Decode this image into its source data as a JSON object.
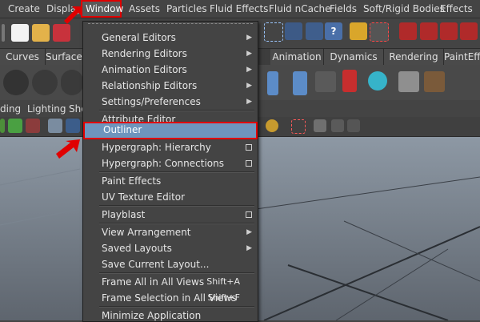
{
  "menubar": {
    "items": [
      "Create",
      "Display",
      "Window",
      "Assets",
      "Particles",
      "Fluid Effects",
      "Fluid nCache",
      "Fields",
      "Soft/Rigid Bodies",
      "Effects"
    ]
  },
  "shelf_tabs": [
    "Curves",
    "Surfaces",
    "Animation",
    "Dynamics",
    "Rendering",
    "PaintEff"
  ],
  "panel_menu": [
    "ding",
    "Lighting",
    "Sho"
  ],
  "window_menu": {
    "items": [
      {
        "label": "General Editors",
        "submenu": true
      },
      {
        "label": "Rendering Editors",
        "submenu": true
      },
      {
        "label": "Animation Editors",
        "submenu": true
      },
      {
        "label": "Relationship Editors",
        "submenu": true
      },
      {
        "label": "Settings/Preferences",
        "submenu": true
      },
      {
        "label": "Attribute Editor"
      },
      {
        "label": "Outliner",
        "highlighted": true
      },
      {
        "label": "Hypergraph: Hierarchy",
        "option_box": true
      },
      {
        "label": "Hypergraph: Connections",
        "option_box": true
      },
      {
        "label": "Paint Effects"
      },
      {
        "label": "UV Texture Editor"
      },
      {
        "label": "Playblast",
        "option_box": true
      },
      {
        "label": "View Arrangement",
        "submenu": true
      },
      {
        "label": "Saved Layouts",
        "submenu": true
      },
      {
        "label": "Save Current Layout..."
      },
      {
        "label": "Frame All in All Views",
        "shortcut": "Shift+A"
      },
      {
        "label": "Frame Selection in All Views",
        "shortcut": "Shift+F"
      },
      {
        "label": "Minimize Application"
      }
    ]
  },
  "colors": {
    "highlight": "#6e95bd",
    "annotation_red": "#e00000",
    "menu_bg": "#444444"
  }
}
